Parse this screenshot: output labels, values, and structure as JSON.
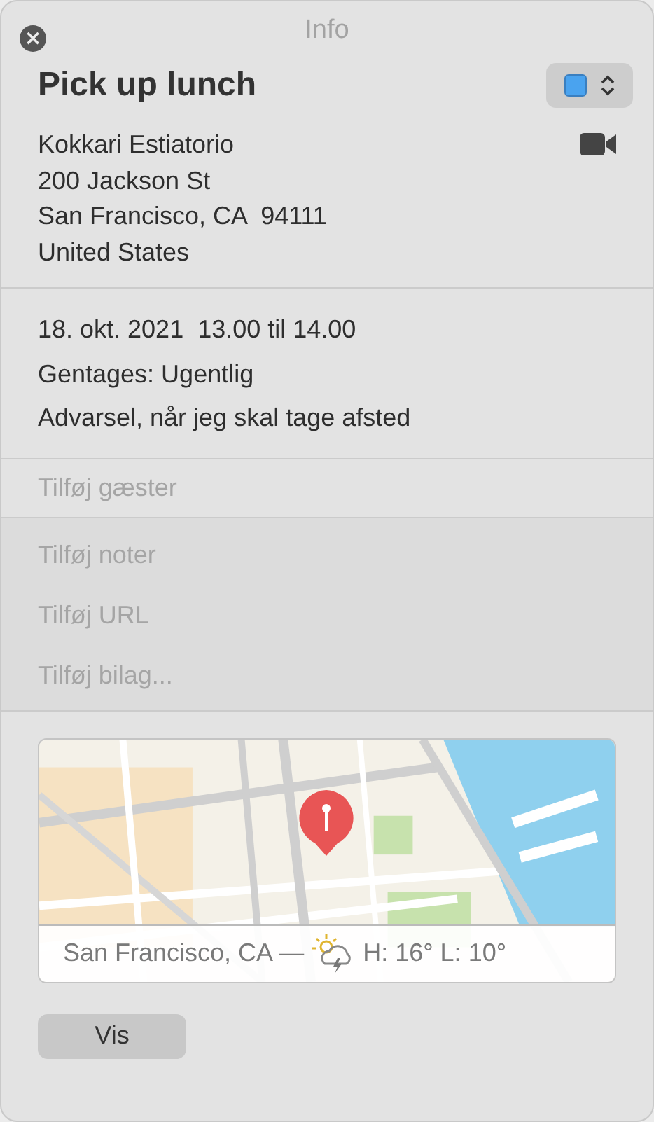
{
  "window": {
    "title": "Info",
    "close_button": "×"
  },
  "event": {
    "title": "Pick up lunch"
  },
  "calendar": {
    "color": "#4aa3ef"
  },
  "location": [
    "Kokkari Estiatorio",
    "200 Jackson St",
    "San Francisco, CA  94111",
    "United States"
  ],
  "schedule": {
    "date": "18. okt. 2021  13.00 til 14.00",
    "repeat": "Gentages: Ugentlig",
    "alert": "Advarsel, når jeg skal tage afsted"
  },
  "guests": {
    "placeholder": "Tilføj gæster"
  },
  "extras": [
    {
      "placeholder": "Tilføj noter"
    },
    {
      "placeholder": "Tilføj URL"
    },
    {
      "placeholder": "Tilføj bilag..."
    }
  ],
  "map": {
    "kind": "picture",
    "place": "San Francisco, CA —",
    "forecast": "H: 16° L: 10°"
  },
  "buttons": [
    "Vis"
  ]
}
